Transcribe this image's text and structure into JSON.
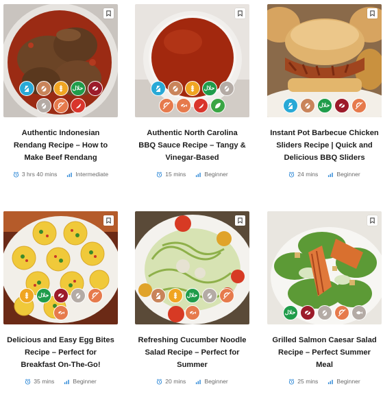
{
  "colors": {
    "time_icon": "#2a86d6",
    "level_icon": "#2a86d6",
    "title": "#1d1d1d",
    "meta": "#6a6a6a"
  },
  "icons": {
    "bookmark": "bookmark-icon",
    "time": "alarm-clock-icon",
    "level": "difficulty-bars-icon"
  },
  "recipes": [
    {
      "title": "Authentic Indonesian Rendang Recipe – How to Make Beef Rendang",
      "time": "3 hrs 40 mins",
      "level": "Intermediate",
      "badges": [
        "no-dairy",
        "no-nut",
        "no-gluten",
        "halal",
        "no-meat",
        "no-egg",
        "no-shellfish",
        "no-chili"
      ],
      "halal_label": "حلال"
    },
    {
      "title": "Authentic North Carolina BBQ Sauce Recipe – Tangy & Vinegar-Based",
      "time": "15 mins",
      "level": "Beginner",
      "badges": [
        "no-dairy",
        "no-nut",
        "no-gluten",
        "halal",
        "no-egg",
        "no-shellfish",
        "no-fish",
        "no-chili",
        "vegan"
      ],
      "halal_label": "حلال"
    },
    {
      "title": "Instant Pot Barbecue Chicken Sliders Recipe | Quick and Delicious BBQ Sliders",
      "time": "24 mins",
      "level": "Beginner",
      "badges": [
        "no-dairy",
        "no-nut",
        "halal",
        "no-meat",
        "no-shellfish"
      ],
      "halal_label": "حلال"
    },
    {
      "title": "Delicious and Easy Egg Bites Recipe – Perfect for Breakfast On-The-Go!",
      "time": "35 mins",
      "level": "Beginner",
      "badges": [
        "no-gluten",
        "halal",
        "no-meat",
        "no-egg",
        "no-shellfish",
        "no-fish"
      ],
      "halal_label": "حلال"
    },
    {
      "title": "Refreshing Cucumber Noodle Salad Recipe – Perfect for Summer",
      "time": "20 mins",
      "level": "Beginner",
      "badges": [
        "no-dairy",
        "no-gluten",
        "halal",
        "no-egg",
        "no-shellfish",
        "no-fish"
      ],
      "halal_label": "حلال"
    },
    {
      "title": "Grilled Salmon Caesar Salad Recipe – Perfect Summer Meal",
      "time": "25 mins",
      "level": "Beginner",
      "badges": [
        "halal",
        "no-meat",
        "no-egg",
        "no-shellfish",
        "fish"
      ],
      "halal_label": "حلال"
    }
  ]
}
